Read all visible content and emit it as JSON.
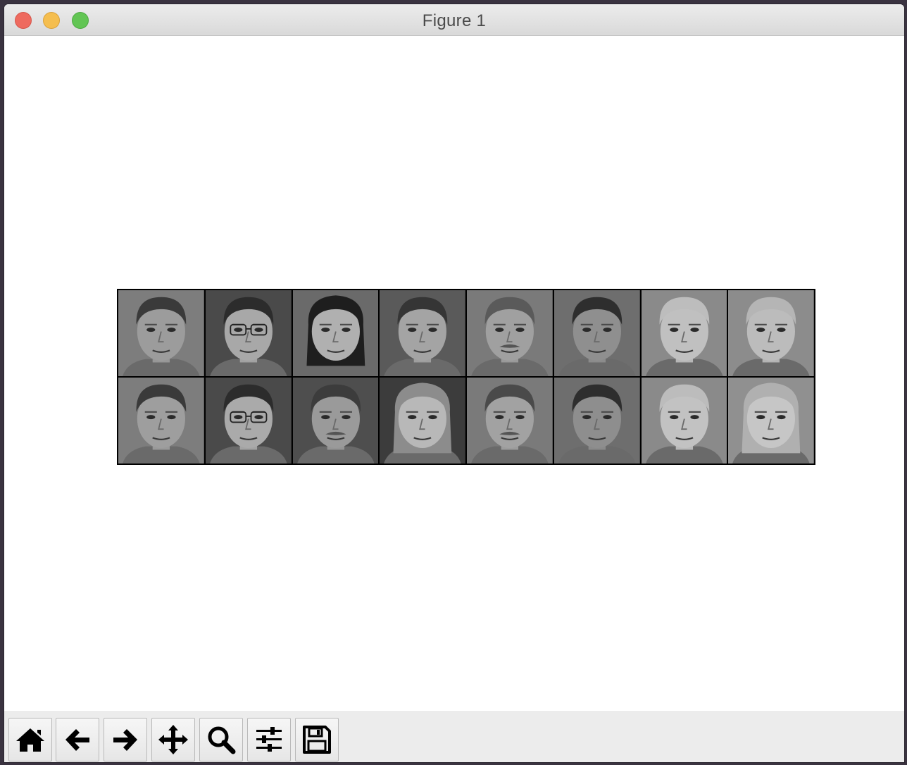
{
  "window": {
    "title": "Figure 1"
  },
  "faces": {
    "rows": 2,
    "cols": 8,
    "tiles": [
      {
        "skin": "#9c9c9c",
        "hair": "#3a3a3a",
        "bg": "#7d7d7d",
        "glasses": false,
        "mustache": false,
        "long_hair": false
      },
      {
        "skin": "#a8a8a8",
        "hair": "#2c2c2c",
        "bg": "#4a4a4a",
        "glasses": true,
        "mustache": false,
        "long_hair": false
      },
      {
        "skin": "#b0b0b0",
        "hair": "#1e1e1e",
        "bg": "#6a6a6a",
        "glasses": false,
        "mustache": false,
        "long_hair": true
      },
      {
        "skin": "#a4a4a4",
        "hair": "#353535",
        "bg": "#5a5a5a",
        "glasses": false,
        "mustache": false,
        "long_hair": false
      },
      {
        "skin": "#a0a0a0",
        "hair": "#5a5a5a",
        "bg": "#7a7a7a",
        "glasses": false,
        "mustache": true,
        "long_hair": false
      },
      {
        "skin": "#8f8f8f",
        "hair": "#2e2e2e",
        "bg": "#6e6e6e",
        "glasses": false,
        "mustache": false,
        "long_hair": false
      },
      {
        "skin": "#c0c0c0",
        "hair": "#bdbdbd",
        "bg": "#8a8a8a",
        "glasses": false,
        "mustache": false,
        "long_hair": false
      },
      {
        "skin": "#bcbcbc",
        "hair": "#b5b5b5",
        "bg": "#8c8c8c",
        "glasses": false,
        "mustache": false,
        "long_hair": false
      },
      {
        "skin": "#9e9e9e",
        "hair": "#3a3a3a",
        "bg": "#7d7d7d",
        "glasses": false,
        "mustache": false,
        "long_hair": false
      },
      {
        "skin": "#aaaaaa",
        "hair": "#2c2c2c",
        "bg": "#4a4a4a",
        "glasses": true,
        "mustache": false,
        "long_hair": false
      },
      {
        "skin": "#9a9a9a",
        "hair": "#3c3c3c",
        "bg": "#4e4e4e",
        "glasses": false,
        "mustache": true,
        "long_hair": false
      },
      {
        "skin": "#b8b8b8",
        "hair": "#8c8c8c",
        "bg": "#3c3c3c",
        "glasses": false,
        "mustache": false,
        "long_hair": true
      },
      {
        "skin": "#a2a2a2",
        "hair": "#4a4a4a",
        "bg": "#7a7a7a",
        "glasses": false,
        "mustache": true,
        "long_hair": false
      },
      {
        "skin": "#8e8e8e",
        "hair": "#2e2e2e",
        "bg": "#6e6e6e",
        "glasses": false,
        "mustache": false,
        "long_hair": false
      },
      {
        "skin": "#c2c2c2",
        "hair": "#bcbcbc",
        "bg": "#8a8a8a",
        "glasses": false,
        "mustache": false,
        "long_hair": false
      },
      {
        "skin": "#c6c6c6",
        "hair": "#b0b0b0",
        "bg": "#909090",
        "glasses": false,
        "mustache": false,
        "long_hair": true
      }
    ]
  },
  "toolbar": {
    "tools": [
      {
        "icon": "home-icon"
      },
      {
        "icon": "back-arrow-icon"
      },
      {
        "icon": "forward-arrow-icon"
      },
      {
        "icon": "pan-move-icon"
      },
      {
        "icon": "zoom-magnifier-icon"
      },
      {
        "icon": "configure-subplots-icon"
      },
      {
        "icon": "save-floppy-icon"
      }
    ]
  }
}
